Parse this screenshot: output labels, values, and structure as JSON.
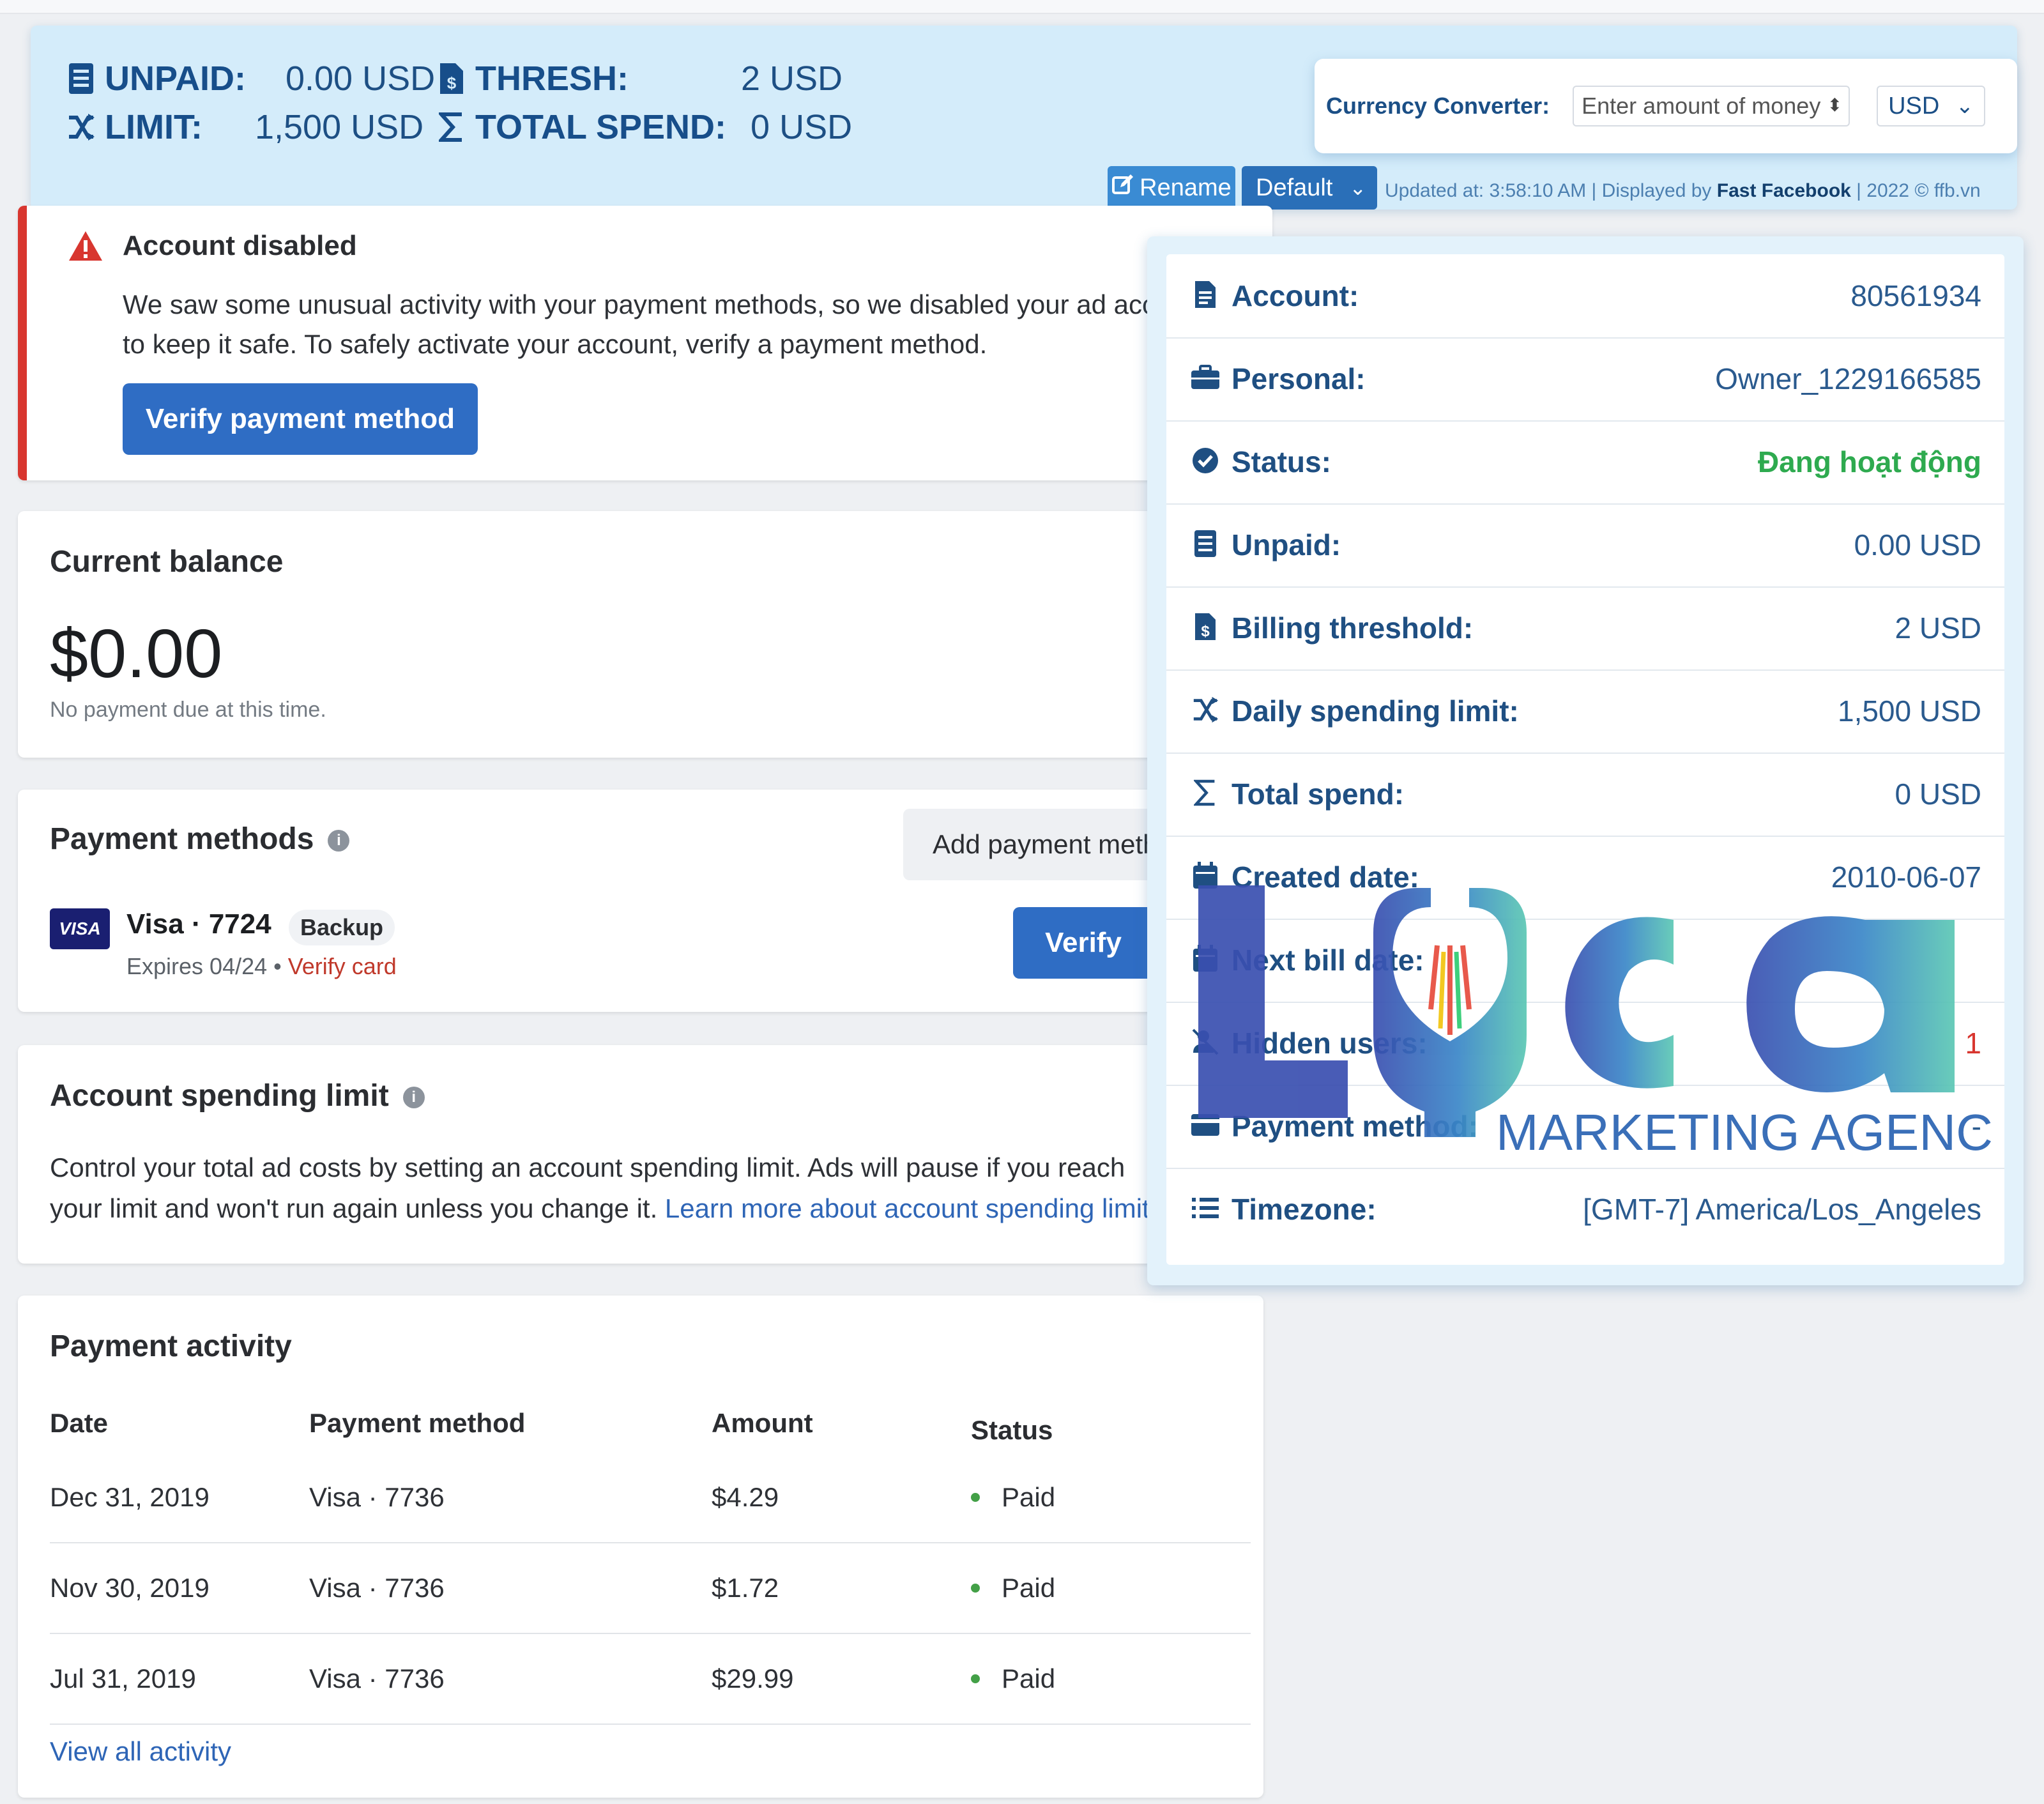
{
  "header": {
    "unpaid_label": "UNPAID:",
    "unpaid_value": "0.00 USD",
    "thresh_label": "THRESH:",
    "thresh_value": "2 USD",
    "limit_label": "LIMIT:",
    "limit_value": "1,500 USD",
    "total_spend_label": "TOTAL SPEND:",
    "total_spend_value": "0 USD",
    "converter_label": "Currency Converter:",
    "converter_placeholder": "Enter amount of money",
    "currency": "USD",
    "rename_label": "Rename",
    "default_label": "Default",
    "updated_prefix": "Updated at: 3:58:10 AM | Displayed by ",
    "updated_brand": "Fast Facebook",
    "updated_suffix": " | 2022 © ffb.vn"
  },
  "alert": {
    "title": "Account disabled",
    "line1": "We saw some unusual activity with your payment methods, so we disabled your ad account",
    "line2": "to keep it safe. To safely activate your account, verify a payment method.",
    "button": "Verify payment method"
  },
  "balance": {
    "title": "Current balance",
    "amount": "$0.00",
    "note": "No payment due at this time."
  },
  "payment_methods": {
    "title": "Payment methods",
    "add_button": "Add payment method",
    "card_brand": "VISA",
    "card_name": "Visa · 7724",
    "badge": "Backup",
    "expires": "Expires 04/24 • ",
    "verify_link": "Verify card",
    "verify_button": "Verify"
  },
  "spending_limit": {
    "title": "Account spending limit",
    "line1": "Control your total ad costs by setting an account spending limit. Ads will pause if you reach",
    "line2": "your limit and won't run again unless you change it. ",
    "link": "Learn more about account spending limits"
  },
  "activity": {
    "title": "Payment activity",
    "columns": [
      "Date",
      "Payment method",
      "Amount",
      "Status"
    ],
    "rows": [
      {
        "date": "Dec 31, 2019",
        "method": "Visa · 7736",
        "amount": "$4.29",
        "status": "Paid"
      },
      {
        "date": "Nov 30, 2019",
        "method": "Visa · 7736",
        "amount": "$1.72",
        "status": "Paid"
      },
      {
        "date": "Jul 31, 2019",
        "method": "Visa · 7736",
        "amount": "$29.99",
        "status": "Paid"
      }
    ],
    "view_all": "View all activity"
  },
  "panel": {
    "rows": [
      {
        "label": "Account:",
        "value": "80561934",
        "icon": "file-icon"
      },
      {
        "label": "Personal:",
        "value": "Owner_1229166585",
        "icon": "briefcase-icon"
      },
      {
        "label": "Status:",
        "value": "Đang hoạt động",
        "icon": "check-circle-icon"
      },
      {
        "label": "Unpaid:",
        "value": "0.00 USD",
        "icon": "receipt-icon"
      },
      {
        "label": "Billing threshold:",
        "value": "2 USD",
        "icon": "invoice-dollar-icon"
      },
      {
        "label": "Daily spending limit:",
        "value": "1,500 USD",
        "icon": "shuffle-icon"
      },
      {
        "label": "Total spend:",
        "value": "0 USD",
        "icon": "sigma-icon"
      },
      {
        "label": "Created date:",
        "value": "2010-06-07",
        "icon": "calendar-icon"
      },
      {
        "label": "Next bill date:",
        "value": "",
        "icon": "calendar-icon"
      },
      {
        "label": "Hidden users:",
        "value": "1",
        "icon": "user-slash-icon"
      },
      {
        "label": "Payment method:",
        "value": "-",
        "icon": "credit-card-icon"
      },
      {
        "label": "Timezone:",
        "value": "[GMT-7] America/Los_Angeles",
        "icon": "list-icon"
      }
    ]
  },
  "watermark": {
    "brand_letters": "Luca",
    "tagline": "MARKETING AGENCY"
  },
  "colors": {
    "brand_blue": "#2f6dc4",
    "header_bg": "#d4ecfa",
    "alert_red": "#d8362f",
    "status_green": "#2eaa4f"
  }
}
